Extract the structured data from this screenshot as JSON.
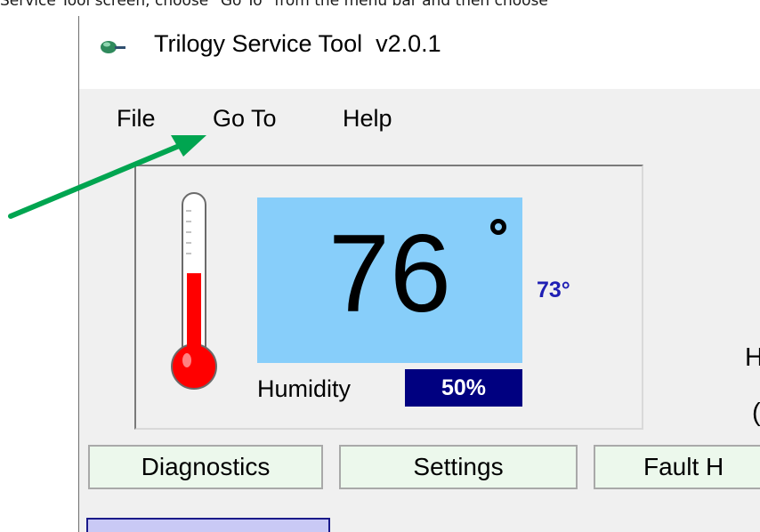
{
  "caption": "Service Tool screen, choose “Go To” from the menu bar and then choose",
  "window": {
    "title": "Trilogy Service Tool  v2.0.1",
    "icon": "app-icon"
  },
  "menu": {
    "items": [
      {
        "label": "File"
      },
      {
        "label": "Go To"
      },
      {
        "label": "Help"
      }
    ]
  },
  "display": {
    "temperature": "76",
    "degree_symbol": "°",
    "setpoint": "73°",
    "humidity_label": "Humidity",
    "humidity_value": "50%",
    "thermometer_level": 0.55,
    "colors": {
      "temp_background": "#87cefa",
      "humidity_background": "#000080",
      "setpoint_text": "#1f1fb4",
      "thermometer_fill": "#ff0000"
    }
  },
  "side_labels": [
    "H",
    "("
  ],
  "nav_buttons": [
    {
      "label": "Diagnostics"
    },
    {
      "label": "Settings"
    },
    {
      "label": "Fault H"
    }
  ],
  "annotation": {
    "type": "arrow",
    "color": "#00a550",
    "points_to": "Go To"
  }
}
